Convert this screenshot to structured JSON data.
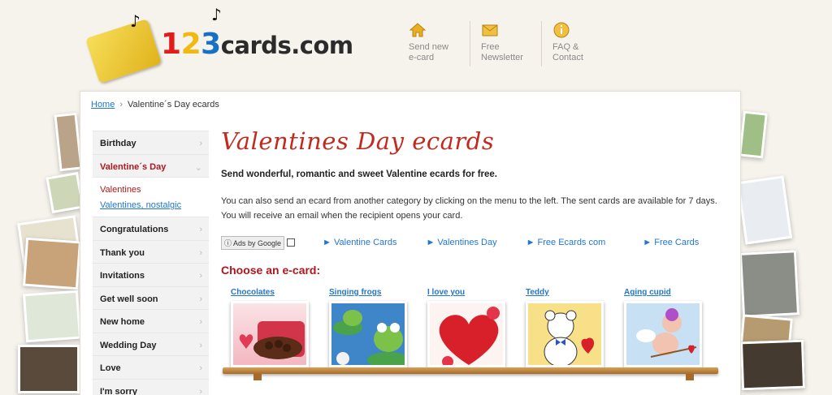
{
  "header": {
    "logo_text": {
      "d1": "1",
      "d2": "2",
      "d3": "3",
      "rest": "cards.com"
    },
    "nav": [
      {
        "label": "Send new\ne-card",
        "icon": "home-icon"
      },
      {
        "label": "Free\nNewsletter",
        "icon": "envelope-icon"
      },
      {
        "label": "FAQ &\nContact",
        "icon": "info-icon"
      }
    ]
  },
  "breadcrumb": {
    "home": "Home",
    "separator": "›",
    "current": "Valentine´s Day ecards"
  },
  "sidebar": {
    "items": [
      {
        "label": "Birthday",
        "arrow": "›"
      },
      {
        "label": "Valentine´s Day",
        "arrow": "⌄"
      },
      {
        "label": "Congratulations",
        "arrow": "›"
      },
      {
        "label": "Thank you",
        "arrow": "›"
      },
      {
        "label": "Invitations",
        "arrow": "›"
      },
      {
        "label": "Get well soon",
        "arrow": "›"
      },
      {
        "label": "New home",
        "arrow": "›"
      },
      {
        "label": "Wedding Day",
        "arrow": "›"
      },
      {
        "label": "Love",
        "arrow": "›"
      },
      {
        "label": "I'm sorry",
        "arrow": "›"
      }
    ],
    "sub": [
      "Valentines",
      "Valentines, nostalgic"
    ]
  },
  "main": {
    "title": "Valentines Day ecards",
    "intro": "Send wonderful, romantic and sweet Valentine ecards for free.",
    "desc": "You can also send an ecard from another category by clicking on the menu to the left. The sent cards are available for 7 days. You will receive an email when the recipient opens your card.",
    "ads_label": "ⓘ Ads by Google",
    "ads": [
      "► Valentine Cards",
      "► Valentines Day",
      "► Free Ecards com",
      "► Free Cards"
    ],
    "choose": "Choose an e-card:",
    "cards": [
      "Chocolates",
      "Singing frogs",
      "I love you",
      "Teddy",
      "Aging cupid"
    ]
  },
  "colors": {
    "accent": "#b0161c",
    "link": "#2277cc",
    "title": "#c22a1d"
  }
}
